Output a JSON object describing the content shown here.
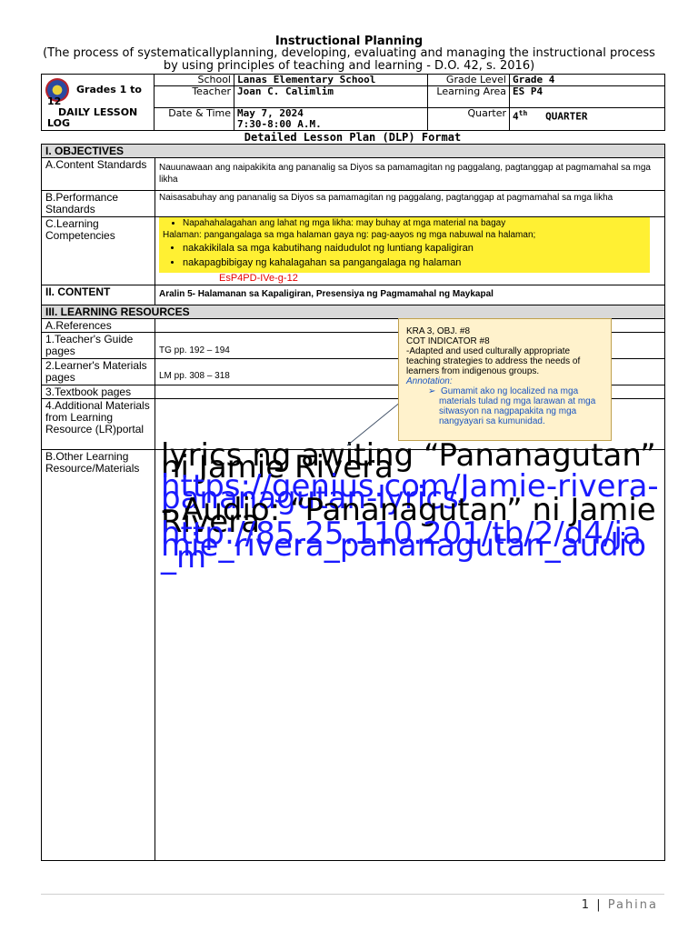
{
  "header": {
    "title": "Instructional Planning",
    "subtitle": "(The process of systematicallyplanning, developing, evaluating and managing the instructional process by using principles of teaching and learning - D.O. 42, s. 2016)"
  },
  "info": {
    "grades": "Grades 1 to 12",
    "log_label": "DAILY LESSON LOG",
    "school_label": "School",
    "school": "Lanas Elementary School",
    "teacher_label": "Teacher",
    "teacher": "Joan C. Calimlim",
    "date_label": "Date & Time",
    "date": "May 7, 2024",
    "time": "7:30-8:00 A.M.",
    "grade_level_label": "Grade Level",
    "grade_level": "Grade 4",
    "learning_area_label": "Learning Area",
    "learning_area": "ES P4",
    "quarter_label": "Quarter",
    "quarter_num": "4",
    "quarter_sup": "th",
    "quarter_word": "QUARTER"
  },
  "dlp_title": "Detailed Lesson Plan (DLP) Format",
  "objectives": {
    "heading": "I. OBJECTIVES",
    "content_label": "A.Content Standards",
    "content": "Nauunawaan ang naipakikita ang pananalig sa Diyos sa pamamagitan ng paggalang, pagtanggap at pagmamahal sa mga likha",
    "performance_label": "B.Performance Standards",
    "performance": "Naisasabuhay ang pananalig sa Diyos sa pamamagitan ng paggalang, pagtanggap at pagmamahal sa mga likha",
    "competencies_label": "C.Learning Competencies",
    "competencies": [
      "Napahahalagahan ang lahat ng mga likha: may buhay at mga material na bagay",
      "nakakikilala sa mga kabutihang naidudulot ng luntiang kapaligiran",
      "nakapagbibigay ng kahalagahan sa pangangalaga ng halaman"
    ],
    "competency_sub": "Halaman: pangangalaga sa mga halaman gaya ng: pag-aayos ng mga nabuwal na halaman;",
    "code": "EsP4PD-IVe-g-12"
  },
  "content": {
    "heading": "II. CONTENT",
    "value": "Aralin 5- Halamanan sa Kapaligiran, Presensiya ng Pagmamahal ng Maykapal"
  },
  "resources": {
    "heading": "III. LEARNING RESOURCES",
    "references_label": "A.References",
    "tg_label": "1.Teacher's Guide pages",
    "tg": "TG pp. 192 – 194",
    "lm_label": "2.Learner's Materials pages",
    "lm": "LM pp. 308 – 318",
    "textbook_label": "3.Textbook pages",
    "additional_label": "4.Additional Materials from Learning Resource (LR)portal",
    "other_label": "B.Other Learning Resource/Materials",
    "other_line1": "lyrics ng awiting “Pananagutan” ni Jamie Rivera",
    "other_link1": "https://genius.com/Jamie-rivera-pananagutan-lyrics",
    "other_line2": "- Audio: “Pananagutan” ni Jamie Rivera",
    "other_link2": "http://85.25.110.201/tb/2/d4/jamie_rivera_pananagutan_audio_m"
  },
  "callout": {
    "line1": "KRA 3, OBJ. #8",
    "line2": "COT INDICATOR #8",
    "line3": "-Adapted and used culturally appropriate teaching strategies to address the needs of learners from indigenous groups.",
    "annotation_label": "Annotation:",
    "annotation": "Gumamit ako ng localized na mga materials tulad ng mga larawan at mga sitwasyon na nagpapakita ng mga nangyayari sa kumunidad."
  },
  "footer": {
    "page_num": "1",
    "separator": "|",
    "page_label": "Pahina"
  },
  "colors": {
    "highlight": "#fff033",
    "link": "#1a1aff",
    "code_red": "#e60000",
    "callout_bg": "#fff2cc",
    "section_bg": "#d9d9d9"
  }
}
